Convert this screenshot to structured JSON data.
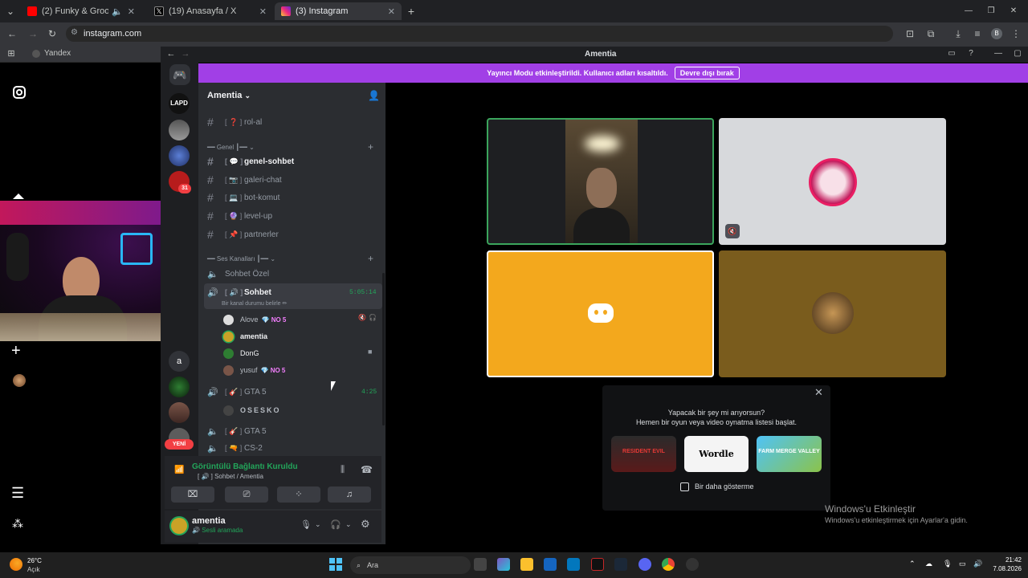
{
  "browser": {
    "tabs": [
      {
        "title": "(2) Funky & Groovy Deep J",
        "active": false
      },
      {
        "title": "(19) Anasayfa / X",
        "active": false
      },
      {
        "title": "(3) Instagram",
        "active": true
      }
    ],
    "url": "instagram.com",
    "bookmark": "Yandex",
    "profile_initial": "B"
  },
  "discord": {
    "window_title": "Amentia",
    "banner_text": "Yayıncı Modu etkinleştirildi. Kullanıcı adları kısaltıldı.",
    "banner_button": "Devre dışı bırak",
    "server_name": "Amentia",
    "server_label_lapd": "LAPD",
    "server_badge_count": "31",
    "server_letter": "a",
    "new_label": "YENİ",
    "channels_top": [
      {
        "name": "rol-al",
        "emoji": "[ ❓ ]"
      }
    ],
    "category_genel": "━━ Genel ┃━━",
    "text_channels": [
      {
        "name": "genel-sohbet",
        "emoji": "[ 💬 ]",
        "bold": true
      },
      {
        "name": "galeri-chat",
        "emoji": "[ 📷 ]",
        "bold": false
      },
      {
        "name": "bot-komut",
        "emoji": "[ 💻 ]",
        "bold": false
      },
      {
        "name": "level-up",
        "emoji": "[ 🔮 ]",
        "bold": false
      },
      {
        "name": "partnerler",
        "emoji": "[ 📌 ]",
        "bold": false
      }
    ],
    "category_ses": "━━ Ses Kanalları ┃━━",
    "voice_channels": {
      "sohbet_ozel": "Sohbet Özel",
      "sohbet": {
        "name": "Sohbet",
        "emoji": "[ 🔊 ]",
        "time": "5:05:14",
        "status": "Bir kanal durumu belirle ✏"
      },
      "users": [
        {
          "name": "Alove",
          "badge": "💎 NO 5"
        },
        {
          "name": "amentia",
          "badge": ""
        },
        {
          "name": "DonG",
          "badge": ""
        },
        {
          "name": "yusuf",
          "badge": "💎 NO 5"
        }
      ],
      "gta1": {
        "name": "GTA 5",
        "emoji": "[ 🎸 ]",
        "time": "4:25"
      },
      "gta1_user": "OSESKO",
      "gta2": {
        "name": "GTA 5",
        "emoji": "[ 🎸 ]"
      },
      "cs2": {
        "name": "CS-2",
        "emoji": "[ 🔫 ]"
      }
    },
    "voice_panel": {
      "status": "Görüntülü Bağlantı Kuruldu",
      "location": "Sohbet / Amentia"
    },
    "user_panel": {
      "name": "amentia",
      "status": "Sesli aramada"
    },
    "activity": {
      "line1": "Yapacak bir şey mi arıyorsun?",
      "line2": "Hemen bir oyun veya video oynatma listesi başlat.",
      "games": [
        "RESIDENT EVIL",
        "Wordle",
        "FARM MERGE VALLEY"
      ],
      "checkbox_label": "Bir daha gösterme"
    }
  },
  "watermark": {
    "title": "Windows'u Etkinleştir",
    "subtitle": "Windows'u etkinleştirmek için Ayarlar'a gidin."
  },
  "taskbar": {
    "weather_temp": "26°C",
    "weather_desc": "Açık",
    "search_placeholder": "Ara",
    "time": "21:42",
    "date": "7.08.2026"
  },
  "colors": {
    "discord_blurple": "#5865f2",
    "banner_purple": "#a13fe6",
    "speaking_green": "#23a55a",
    "yellow_tile": "#f3a81d"
  }
}
